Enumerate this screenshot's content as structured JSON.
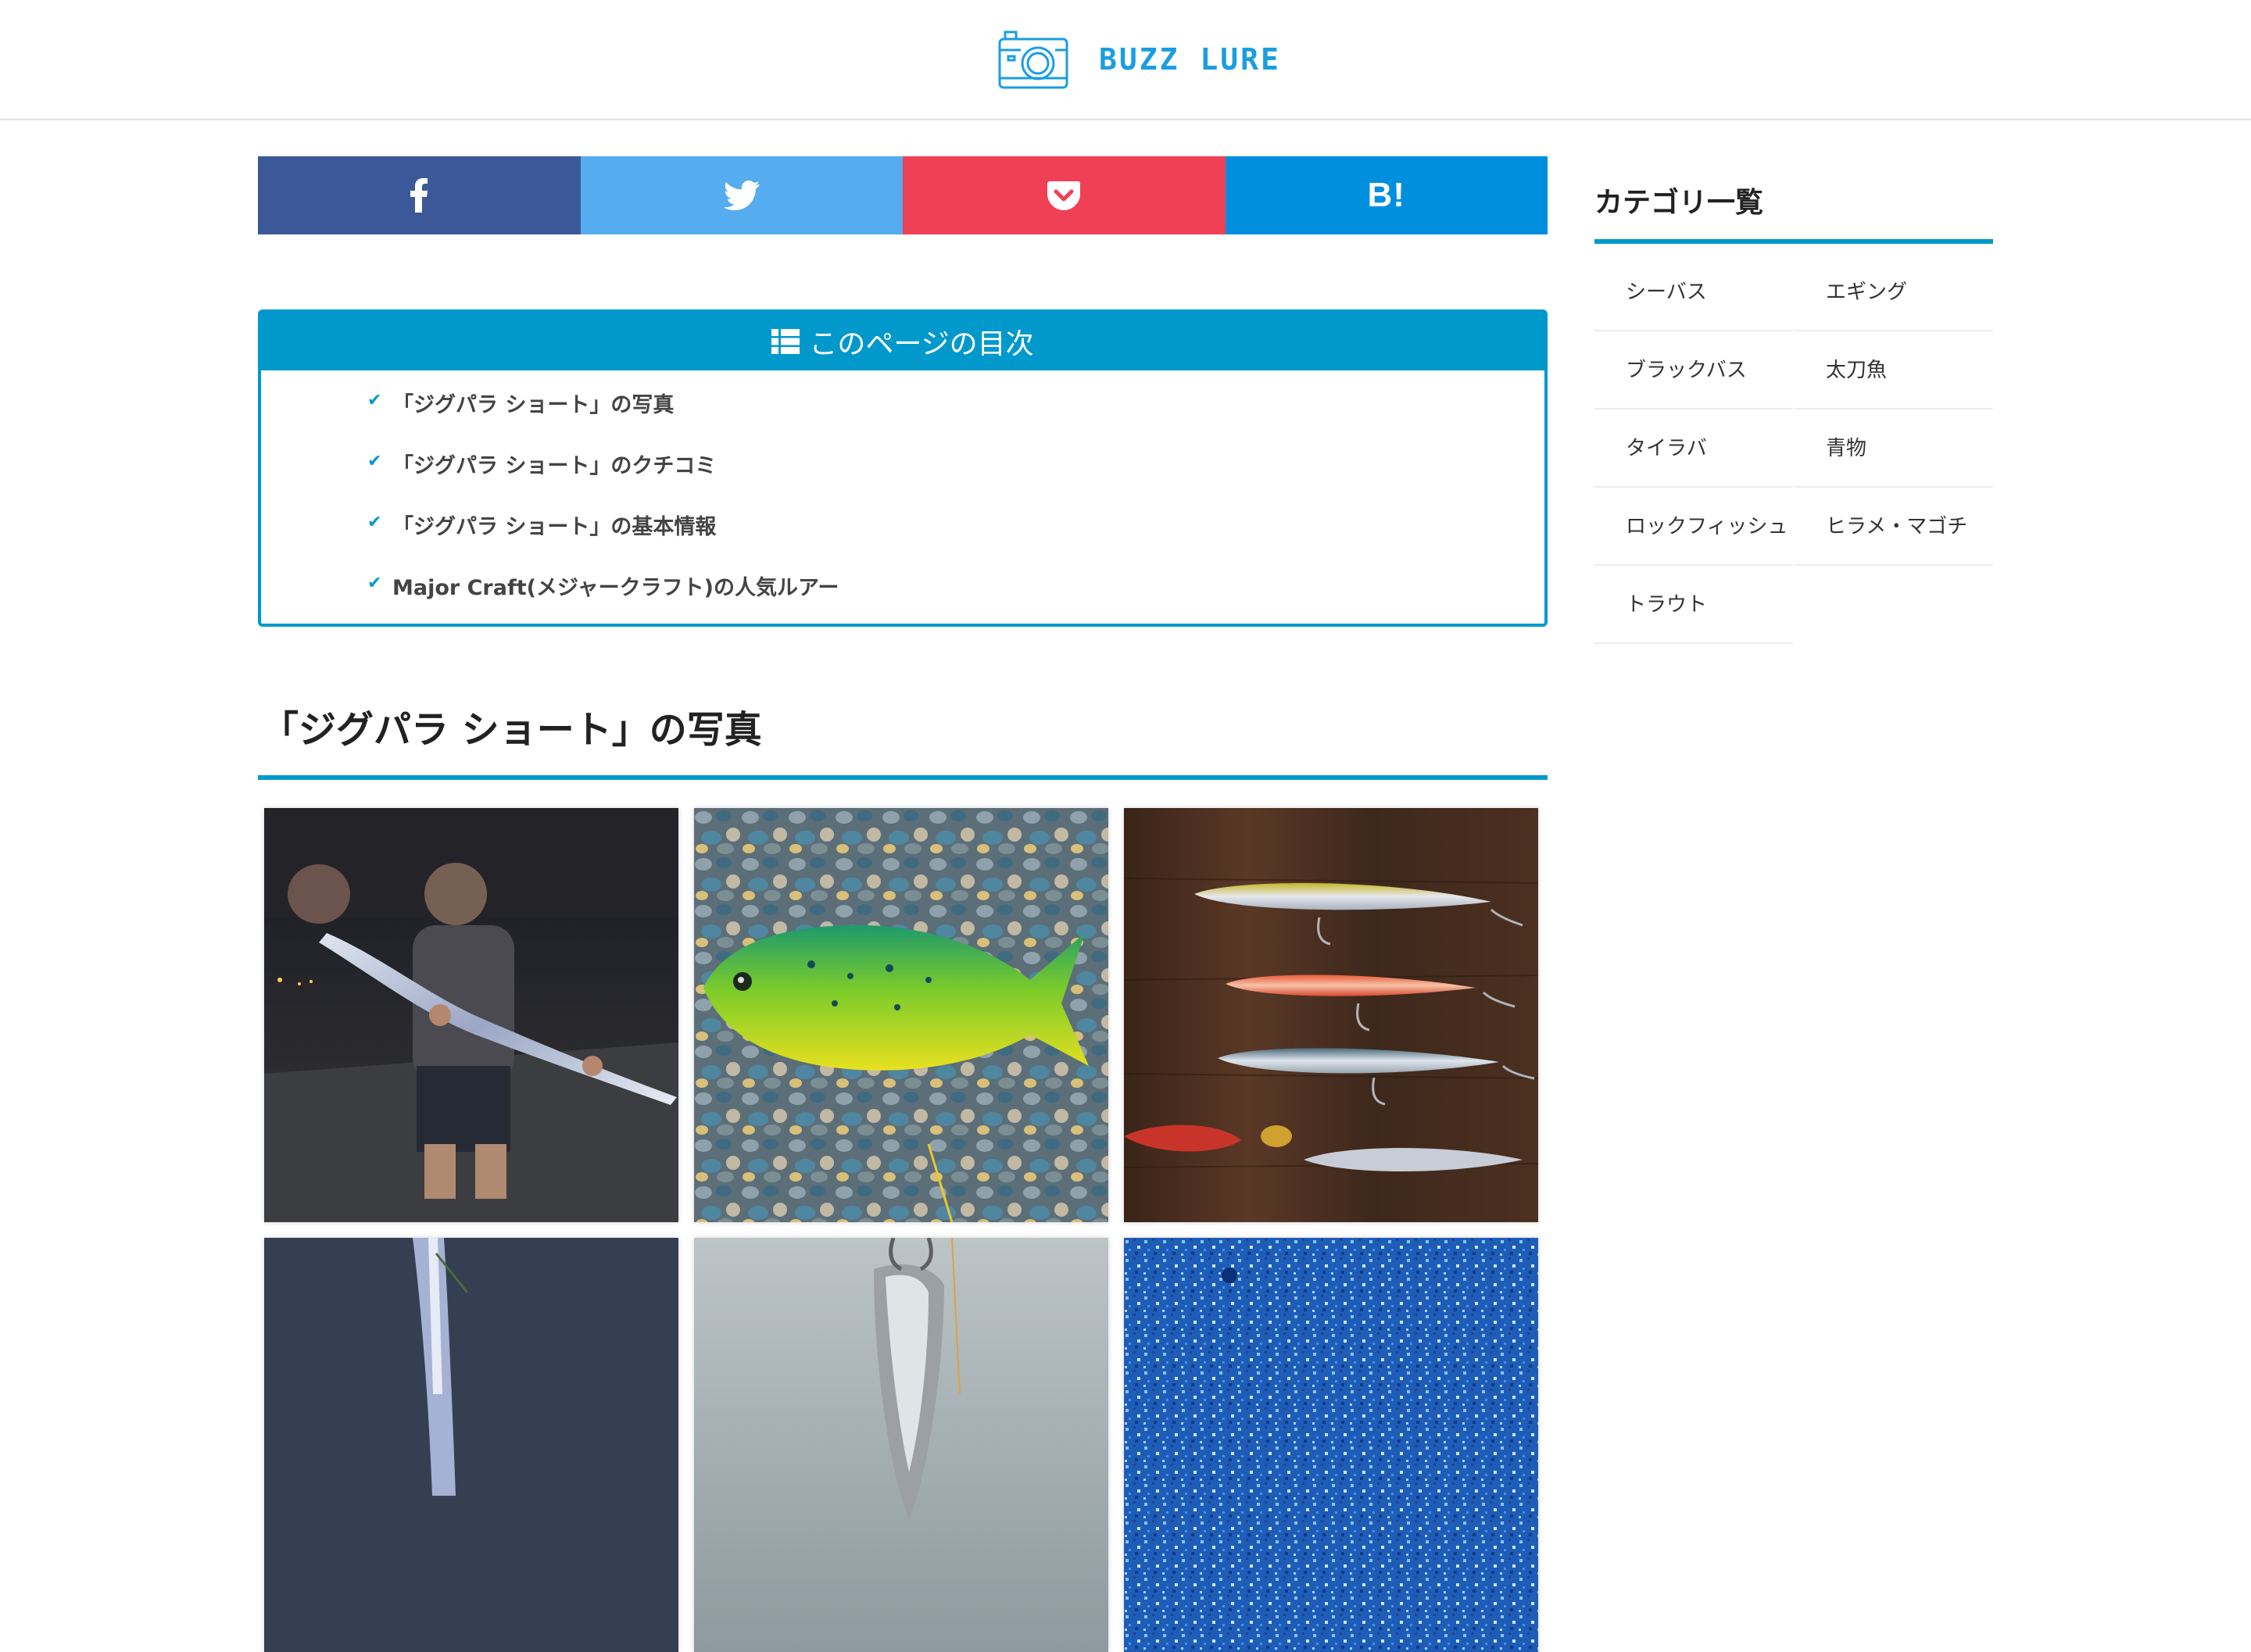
{
  "header": {
    "logo_text": "BUZZ LURE"
  },
  "share": {
    "facebook": "facebook-icon",
    "twitter": "twitter-icon",
    "pocket": "pocket-icon",
    "hatena_label": "B!"
  },
  "toc": {
    "title": "このページの目次",
    "items": [
      {
        "label": "「ジグパラ ショート」の写真"
      },
      {
        "label": "「ジグパラ ショート」のクチコミ"
      },
      {
        "label": "「ジグパラ ショート」の基本情報"
      },
      {
        "label": "Major Craft(メジャークラフト)の人気ルアー"
      }
    ]
  },
  "section": {
    "photos_title": "「ジグパラ ショート」の写真"
  },
  "sidebar": {
    "title": "カテゴリ一覧",
    "categories": [
      {
        "label": "シーバス"
      },
      {
        "label": "エギング"
      },
      {
        "label": "ブラックバス"
      },
      {
        "label": "太刀魚"
      },
      {
        "label": "タイラバ"
      },
      {
        "label": "青物"
      },
      {
        "label": "ロックフィッシュ"
      },
      {
        "label": "ヒラメ・マゴチ"
      },
      {
        "label": "トラウト"
      }
    ]
  },
  "colors": {
    "accent": "#0199cc",
    "logo": "#1a9ee0",
    "facebook": "#3b5998",
    "twitter": "#55acee",
    "pocket": "#ef4056",
    "hatena": "#008fde"
  }
}
